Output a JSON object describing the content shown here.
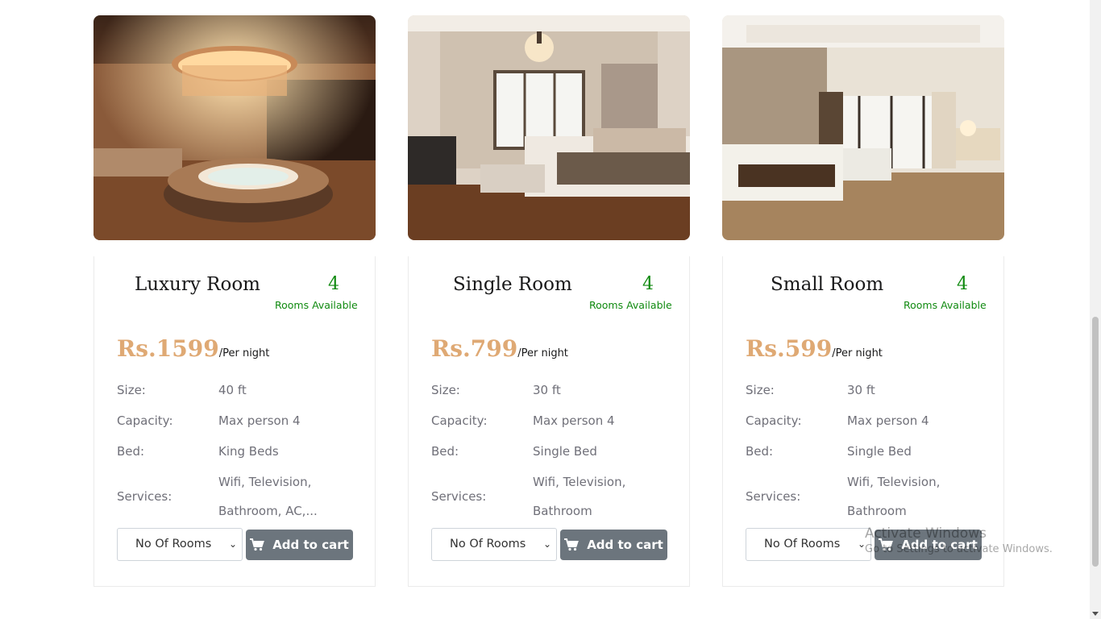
{
  "rooms": [
    {
      "title": "Luxury Room",
      "available_count": "4",
      "available_label": "Rooms Available",
      "price": "Rs.1599",
      "price_unit": "/Per night",
      "size_label": "Size:",
      "size": "40 ft",
      "capacity_label": "Capacity:",
      "capacity": "Max person 4",
      "bed_label": "Bed:",
      "bed": "King Beds",
      "services_label": "Services:",
      "services_line1": "Wifi, Television,",
      "services_line2": "Bathroom, AC,...",
      "select_placeholder": "No Of Rooms",
      "cart_label": "Add to cart"
    },
    {
      "title": "Single Room",
      "available_count": "4",
      "available_label": "Rooms Available",
      "price": "Rs.799",
      "price_unit": "/Per night",
      "size_label": "Size:",
      "size": "30 ft",
      "capacity_label": "Capacity:",
      "capacity": "Max person 4",
      "bed_label": "Bed:",
      "bed": "Single Bed",
      "services_label": "Services:",
      "services_line1": "Wifi, Television,",
      "services_line2": "Bathroom",
      "select_placeholder": "No Of Rooms",
      "cart_label": "Add to cart"
    },
    {
      "title": "Small Room",
      "available_count": "4",
      "available_label": "Rooms Available",
      "price": "Rs.599",
      "price_unit": "/Per night",
      "size_label": "Size:",
      "size": "30 ft",
      "capacity_label": "Capacity:",
      "capacity": "Max person 4",
      "bed_label": "Bed:",
      "bed": "Single Bed",
      "services_label": "Services:",
      "services_line1": "Wifi, Television,",
      "services_line2": "Bathroom",
      "select_placeholder": "No Of Rooms",
      "cart_label": "Add to cart"
    }
  ],
  "watermark": {
    "line1": "Activate Windows",
    "line2": "Go to Settings to activate Windows."
  },
  "colors": {
    "price": "#dfa974",
    "available": "#108a10",
    "button": "#6c757d"
  },
  "icons": {
    "cart": "shopping-cart-icon",
    "select": "chevron-down-icon"
  }
}
